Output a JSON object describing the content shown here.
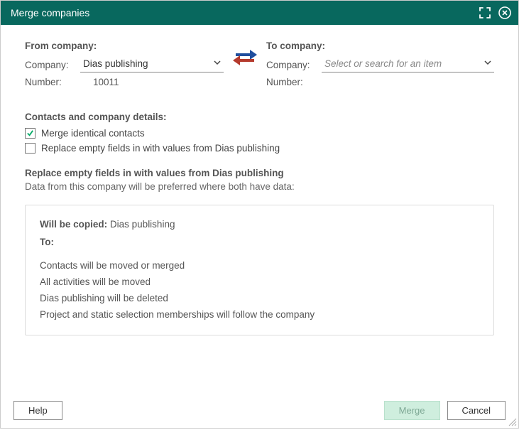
{
  "titlebar": {
    "title": "Merge companies"
  },
  "from": {
    "heading": "From company:",
    "company_label": "Company:",
    "company_value": "Dias publishing",
    "number_label": "Number:",
    "number_value": "10011"
  },
  "to": {
    "heading": "To company:",
    "company_label": "Company:",
    "company_placeholder": "Select or search for an item",
    "number_label": "Number:",
    "number_value": ""
  },
  "contacts": {
    "heading": "Contacts and company details:",
    "merge_contacts_label": "Merge identical contacts",
    "merge_contacts_checked": true,
    "replace_empty_label": "Replace empty fields in with values from Dias publishing",
    "replace_empty_checked": false
  },
  "replace": {
    "title": "Replace empty fields in with values from Dias publishing",
    "subtitle": "Data from this company will be preferred where both have data:"
  },
  "summary": {
    "copied_label": "Will be copied:",
    "copied_value": " Dias publishing",
    "to_label": "To:",
    "lines": [
      "Contacts will be moved or merged",
      "All activities will be moved",
      "Dias publishing will be deleted",
      "Project and static selection memberships will follow the company"
    ]
  },
  "footer": {
    "help": "Help",
    "merge": "Merge",
    "cancel": "Cancel"
  }
}
